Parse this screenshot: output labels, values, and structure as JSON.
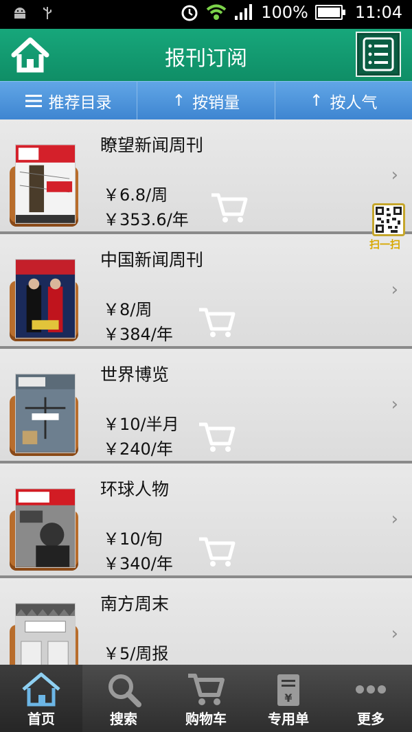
{
  "status_bar": {
    "battery": "100%",
    "time": "11:04"
  },
  "header": {
    "title": "报刊订阅"
  },
  "sort_tabs": [
    {
      "label": "推荐目录",
      "icon": "list-icon"
    },
    {
      "label": "按销量",
      "icon": "arrow-up-icon"
    },
    {
      "label": "按人气",
      "icon": "arrow-up-icon"
    }
  ],
  "items": [
    {
      "name": "瞭望新闻周刊",
      "price1": "￥6.8/周",
      "price2": "￥353.6/年"
    },
    {
      "name": "中国新闻周刊",
      "price1": "￥8/周",
      "price2": "￥384/年"
    },
    {
      "name": "世界博览",
      "price1": "￥10/半月",
      "price2": "￥240/年"
    },
    {
      "name": "环球人物",
      "price1": "￥10/旬",
      "price2": "￥340/年"
    },
    {
      "name": "南方周末",
      "price1": "￥5/周报",
      "price2": ""
    }
  ],
  "scan": {
    "label": "扫一扫"
  },
  "bottom_nav": [
    {
      "label": "首页",
      "icon": "home-icon"
    },
    {
      "label": "搜索",
      "icon": "search-icon"
    },
    {
      "label": "购物车",
      "icon": "cart-icon"
    },
    {
      "label": "专用单",
      "icon": "receipt-icon"
    },
    {
      "label": "更多",
      "icon": "more-icon"
    }
  ]
}
